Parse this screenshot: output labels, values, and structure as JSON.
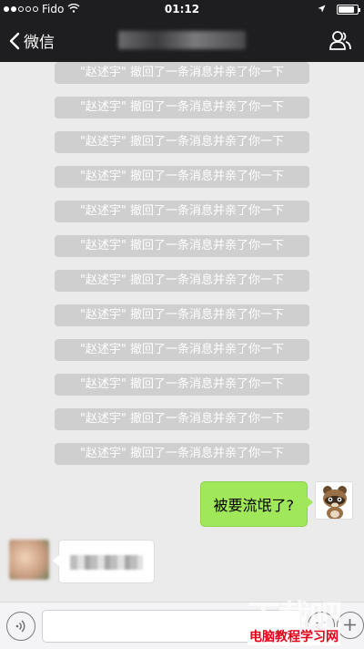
{
  "status_bar": {
    "carrier": "Fido",
    "time": "01:12",
    "battery_level": 0.85
  },
  "nav": {
    "back_label": "微信",
    "title": "",
    "contacts_icon": "contacts-icon"
  },
  "system_messages": [
    "\"赵述宇\" 撤回了一条消息并亲了你一下",
    "\"赵述宇\" 撤回了一条消息并亲了你一下",
    "\"赵述宇\" 撤回了一条消息并亲了你一下",
    "\"赵述宇\" 撤回了一条消息并亲了你一下",
    "\"赵述宇\" 撤回了一条消息并亲了你一下",
    "\"赵述宇\" 撤回了一条消息并亲了你一下",
    "\"赵述宇\" 撤回了一条消息并亲了你一下",
    "\"赵述宇\" 撤回了一条消息并亲了你一下",
    "\"赵述宇\" 撤回了一条消息并亲了你一下",
    "\"赵述宇\" 撤回了一条消息并亲了你一下",
    "\"赵述宇\" 撤回了一条消息并亲了你一下",
    "\"赵述宇\" 撤回了一条消息并亲了你一下"
  ],
  "outgoing_message": "被要流氓了?",
  "incoming_message": "",
  "input": {
    "value": "",
    "placeholder": ""
  },
  "watermark": {
    "logo_text": "下载吧",
    "site_text": "电脑教程学习网"
  },
  "colors": {
    "bar_bg": "#1e1e20",
    "chat_bg": "#ebebeb",
    "sys_bubble": "#cfcfcf",
    "outgoing_bubble": "#a0e75a"
  }
}
